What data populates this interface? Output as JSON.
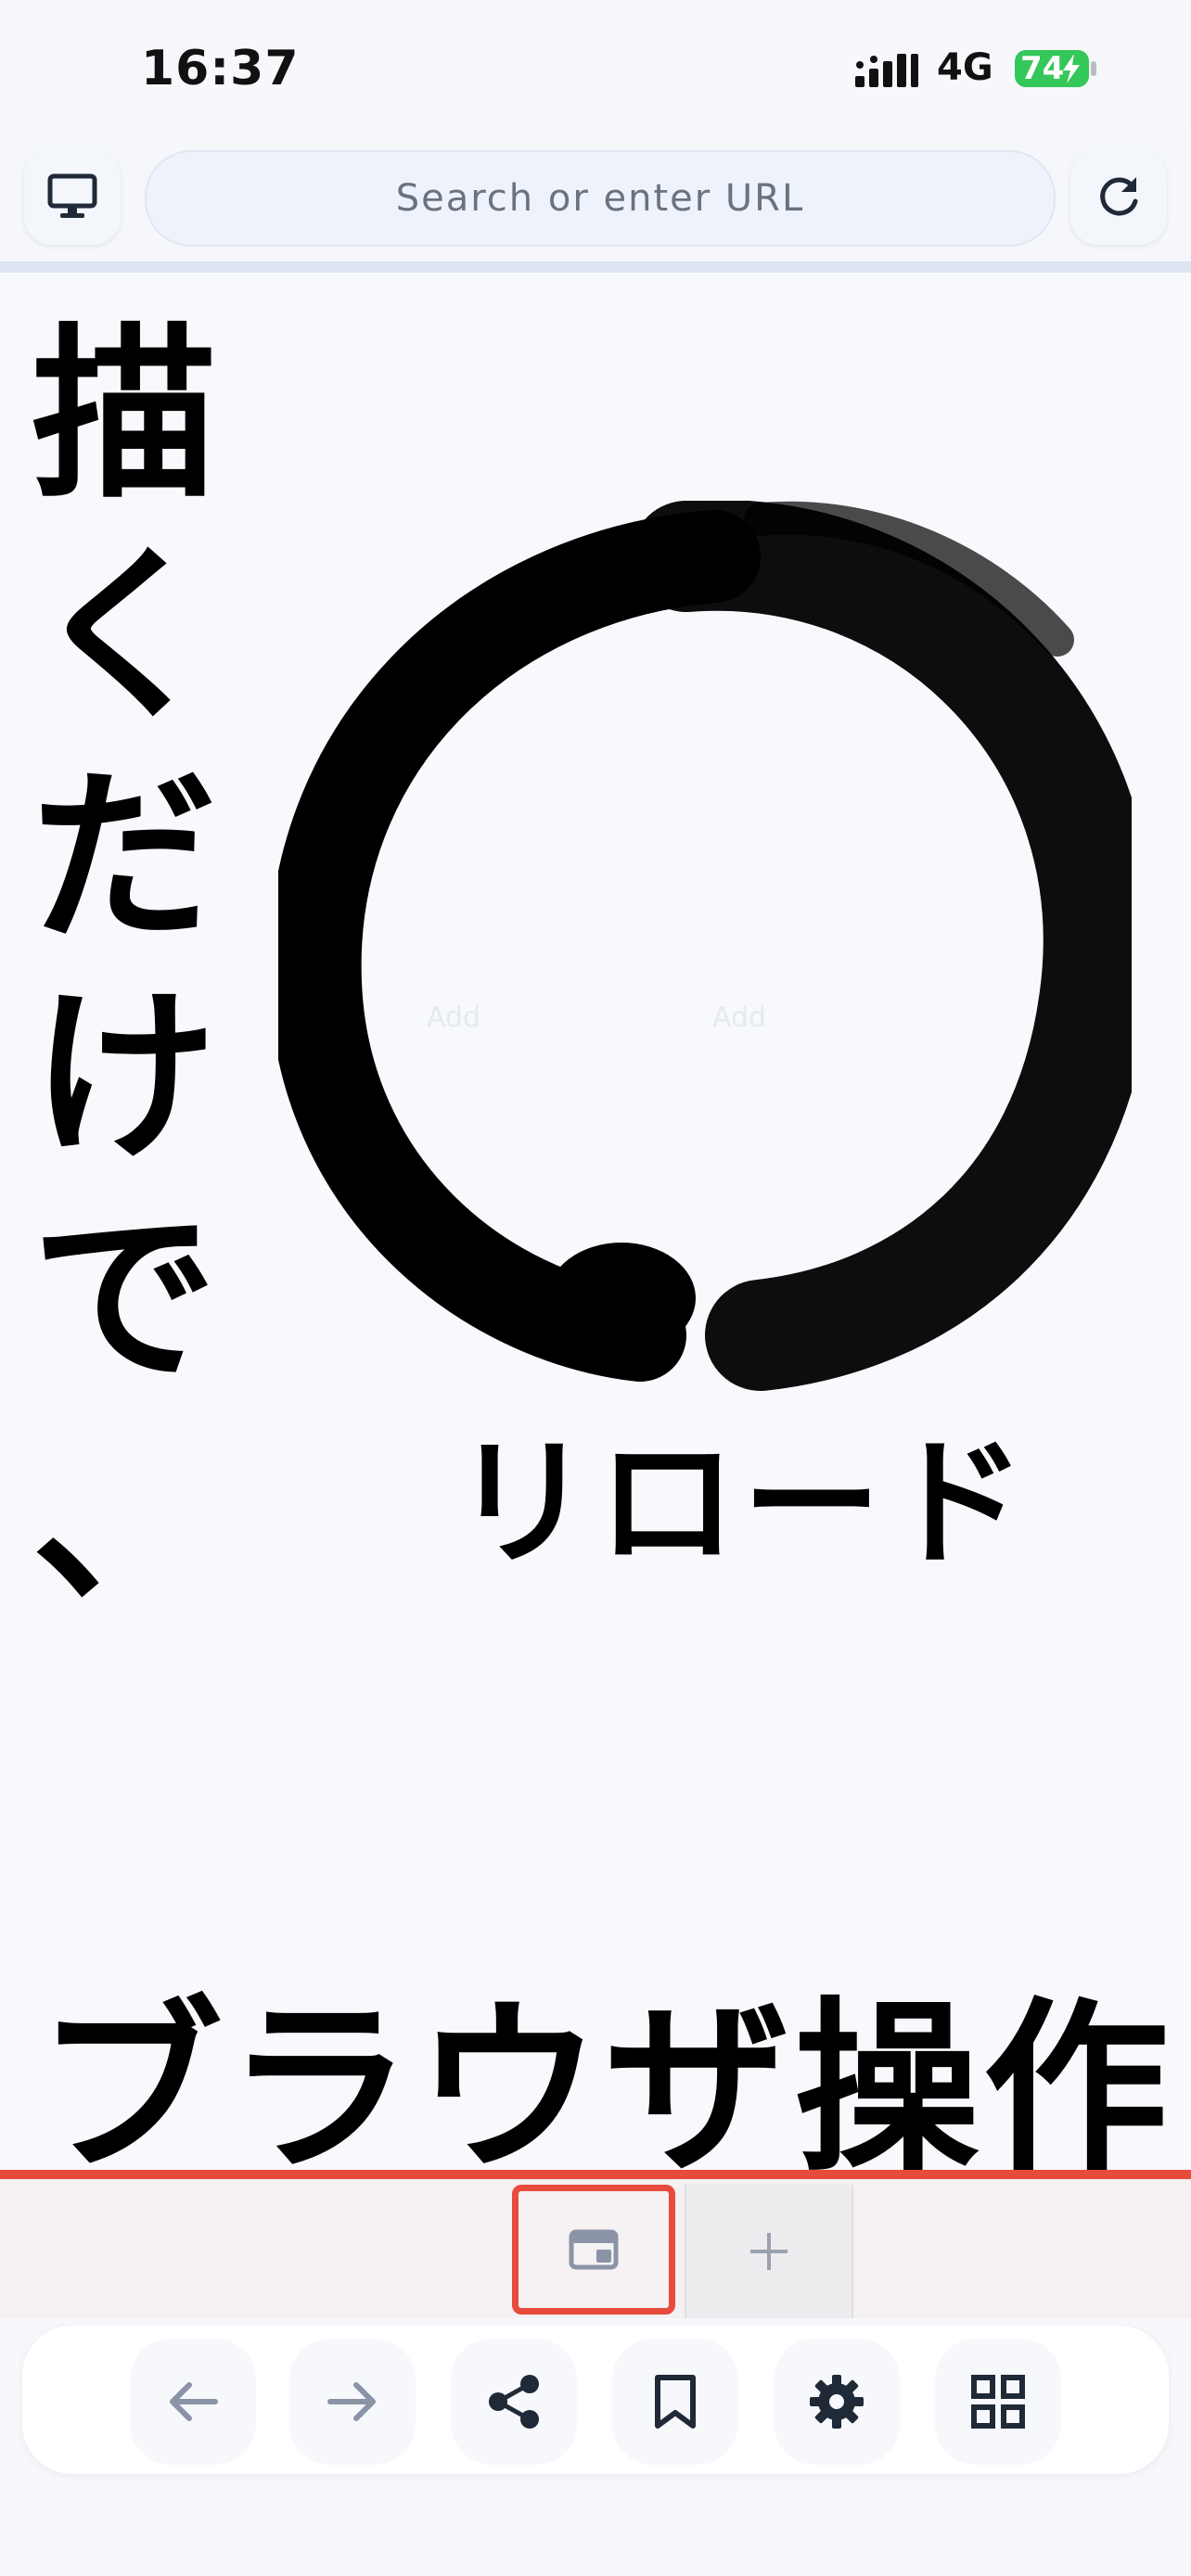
{
  "status_bar": {
    "time": "16:37",
    "network": "4G",
    "battery": "74"
  },
  "address_bar": {
    "placeholder": "Search or enter URL"
  },
  "content": {
    "vertical_text": [
      "描",
      "く",
      "だ",
      "け",
      "で",
      "、"
    ],
    "bottom_text": "ブラウザ操作",
    "reload_text": "リロード"
  },
  "colors": {
    "accent": "#e64b3c",
    "battery": "#34c759",
    "icon": "#1f2937",
    "icon_muted": "#8a94a6"
  },
  "icons": {
    "desktop": "desktop-icon",
    "reload": "reload-icon",
    "tab": "tab-icon",
    "add": "plus-icon",
    "back": "arrow-left-icon",
    "forward": "arrow-right-icon",
    "share": "share-icon",
    "bookmark": "bookmark-icon",
    "settings": "gear-icon",
    "tabs_grid": "grid-icon"
  }
}
